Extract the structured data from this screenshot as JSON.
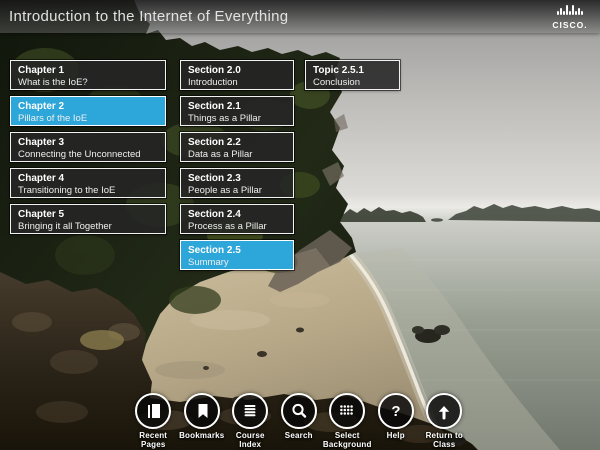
{
  "header": {
    "title": "Introduction to the Internet of Everything",
    "brand": "CISCO."
  },
  "colors": {
    "highlight_blue": "#2da6d9",
    "tile_dark": "rgba(38,38,38,0.88)"
  },
  "index": {
    "chapters": [
      {
        "kicker": "Chapter 1",
        "title": "What is the IoE?",
        "active": false
      },
      {
        "kicker": "Chapter 2",
        "title": "Pillars of the IoE",
        "active": true
      },
      {
        "kicker": "Chapter 3",
        "title": "Connecting the Unconnected",
        "active": false
      },
      {
        "kicker": "Chapter 4",
        "title": "Transitioning to the IoE",
        "active": false
      },
      {
        "kicker": "Chapter 5",
        "title": "Bringing it all Together",
        "active": false
      }
    ],
    "sections": [
      {
        "kicker": "Section 2.0",
        "title": "Introduction",
        "active": false
      },
      {
        "kicker": "Section 2.1",
        "title": "Things as a Pillar",
        "active": false
      },
      {
        "kicker": "Section 2.2",
        "title": "Data as a Pillar",
        "active": false
      },
      {
        "kicker": "Section 2.3",
        "title": "People as a Pillar",
        "active": false
      },
      {
        "kicker": "Section 2.4",
        "title": "Process as a Pillar",
        "active": false
      },
      {
        "kicker": "Section 2.5",
        "title": "Summary",
        "active": true
      }
    ],
    "topics": [
      {
        "kicker": "Topic 2.5.1",
        "title": "Conclusion",
        "active": false
      }
    ]
  },
  "toolbar": {
    "items": [
      {
        "icon": "recent-pages-icon",
        "label": "Recent\nPages"
      },
      {
        "icon": "bookmarks-icon",
        "label": "Bookmarks"
      },
      {
        "icon": "course-index-icon",
        "label": "Course\nIndex"
      },
      {
        "icon": "search-icon",
        "label": "Search"
      },
      {
        "icon": "select-background-icon",
        "label": "Select\nBackground"
      },
      {
        "icon": "help-icon",
        "label": "Help"
      },
      {
        "icon": "return-to-class-icon",
        "label": "Return to\nClass"
      }
    ]
  }
}
